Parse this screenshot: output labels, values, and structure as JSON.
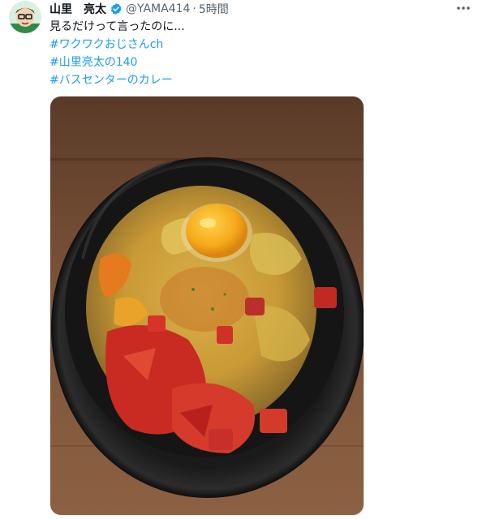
{
  "tweet": {
    "author": {
      "display_name": "山里　亮太",
      "handle": "@YAMA414",
      "avatar_icon": "avatar-caricature-icon",
      "verified": true
    },
    "separator": "·",
    "timestamp": "5時間",
    "more_icon": "more-horizontal-icon",
    "text": "見るだけって言ったのに...",
    "hashtags": [
      "#ワクワクおじさんch",
      "#山里亮太の140",
      "#バスセンターのカレー"
    ],
    "media": {
      "type": "photo",
      "icon": "curry-bowl-photo"
    }
  },
  "colors": {
    "hashtag": "#1d9bf0",
    "secondary_text": "#536471",
    "verified_badge": "#1d9bf0"
  }
}
